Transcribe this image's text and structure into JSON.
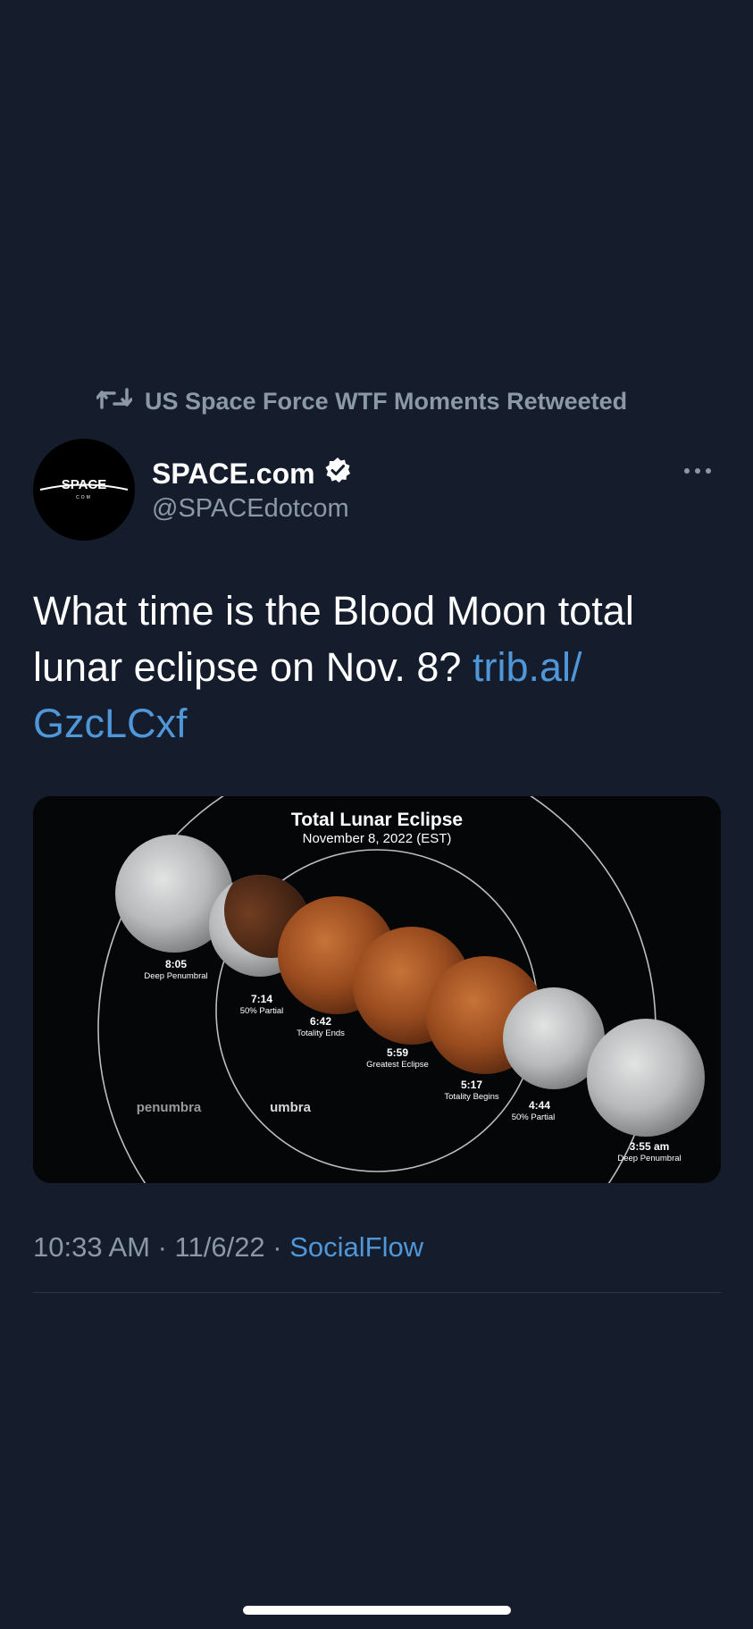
{
  "retweet": {
    "text": "US Space Force WTF Moments Retweeted",
    "icon": "retweet-icon"
  },
  "author": {
    "display_name": "SPACE.com",
    "handle": "@SPACEdotcom",
    "verified_icon": "verified-badge-icon",
    "avatar_logo_text": "SPACE",
    "avatar_logo_subtext": "COM"
  },
  "more_icon": "more-icon",
  "tweet": {
    "text_before_link": "What time is the Blood Moon total lunar eclipse on Nov. 8? ",
    "link_text": "trib.al/\nGzcLCxf"
  },
  "media": {
    "title": "Total Lunar Eclipse",
    "subtitle": "November 8, 2022 (EST)",
    "region_penumbra": "penumbra",
    "region_umbra": "umbra",
    "phases": [
      {
        "time": "8:05",
        "label": "Deep Penumbral"
      },
      {
        "time": "7:14",
        "label": "50% Partial"
      },
      {
        "time": "6:42",
        "label": "Totality Ends"
      },
      {
        "time": "5:59",
        "label": "Greatest Eclipse"
      },
      {
        "time": "5:17",
        "label": "Totality Begins"
      },
      {
        "time": "4:44",
        "label": "50% Partial"
      },
      {
        "time": "3:55 am",
        "label": "Deep Penumbral"
      }
    ]
  },
  "meta": {
    "time": "10:33 AM",
    "separator": " · ",
    "date": "11/6/22",
    "source": "SocialFlow"
  },
  "colors": {
    "background": "#151d2c",
    "accent_link": "#4f97d8",
    "secondary_text": "#8b98a5"
  }
}
